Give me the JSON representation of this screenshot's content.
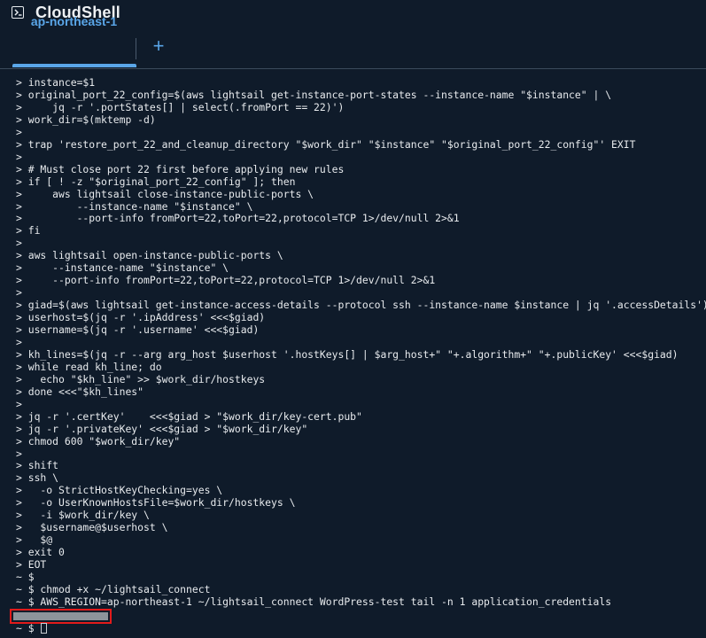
{
  "app": {
    "title": "CloudShell",
    "icon": "terminal-icon"
  },
  "tabs": [
    {
      "label": "ap-northeast-1",
      "active": true
    }
  ],
  "add_tab_label": "+",
  "colors": {
    "background": "#0f1b2a",
    "accent": "#5aa6e8",
    "redaction_border": "#e21b1b"
  },
  "terminal": {
    "lines": [
      "> instance=$1",
      "> original_port_22_config=$(aws lightsail get-instance-port-states --instance-name \"$instance\" | \\",
      ">     jq -r '.portStates[] | select(.fromPort == 22)')",
      "> work_dir=$(mktemp -d)",
      ">",
      "> trap 'restore_port_22_and_cleanup_directory \"$work_dir\" \"$instance\" \"$original_port_22_config\"' EXIT",
      ">",
      "> # Must close port 22 first before applying new rules",
      "> if [ ! -z \"$original_port_22_config\" ]; then",
      ">     aws lightsail close-instance-public-ports \\",
      ">         --instance-name \"$instance\" \\",
      ">         --port-info fromPort=22,toPort=22,protocol=TCP 1>/dev/null 2>&1",
      "> fi",
      ">",
      "> aws lightsail open-instance-public-ports \\",
      ">     --instance-name \"$instance\" \\",
      ">     --port-info fromPort=22,toPort=22,protocol=TCP 1>/dev/null 2>&1",
      ">",
      "> giad=$(aws lightsail get-instance-access-details --protocol ssh --instance-name $instance | jq '.accessDetails')",
      "> userhost=$(jq -r '.ipAddress' <<<$giad)",
      "> username=$(jq -r '.username' <<<$giad)",
      ">",
      "> kh_lines=$(jq -r --arg arg_host $userhost '.hostKeys[] | $arg_host+\" \"+.algorithm+\" \"+.publicKey' <<<$giad)",
      "> while read kh_line; do",
      ">   echo \"$kh_line\" >> $work_dir/hostkeys",
      "> done <<<\"$kh_lines\"",
      ">",
      "> jq -r '.certKey'    <<<$giad > \"$work_dir/key-cert.pub\"",
      "> jq -r '.privateKey' <<<$giad > \"$work_dir/key\"",
      "> chmod 600 \"$work_dir/key\"",
      ">",
      "> shift",
      "> ssh \\",
      ">   -o StrictHostKeyChecking=yes \\",
      ">   -o UserKnownHostsFile=$work_dir/hostkeys \\",
      ">   -i $work_dir/key \\",
      ">   $username@$userhost \\",
      ">   $@",
      "> exit 0",
      "> EOT",
      "~ $",
      "~ $ chmod +x ~/lightsail_connect",
      "~ $ AWS_REGION=ap-northeast-1 ~/lightsail_connect WordPress-test tail -n 1 application_credentials"
    ],
    "prompt": "~ $"
  }
}
